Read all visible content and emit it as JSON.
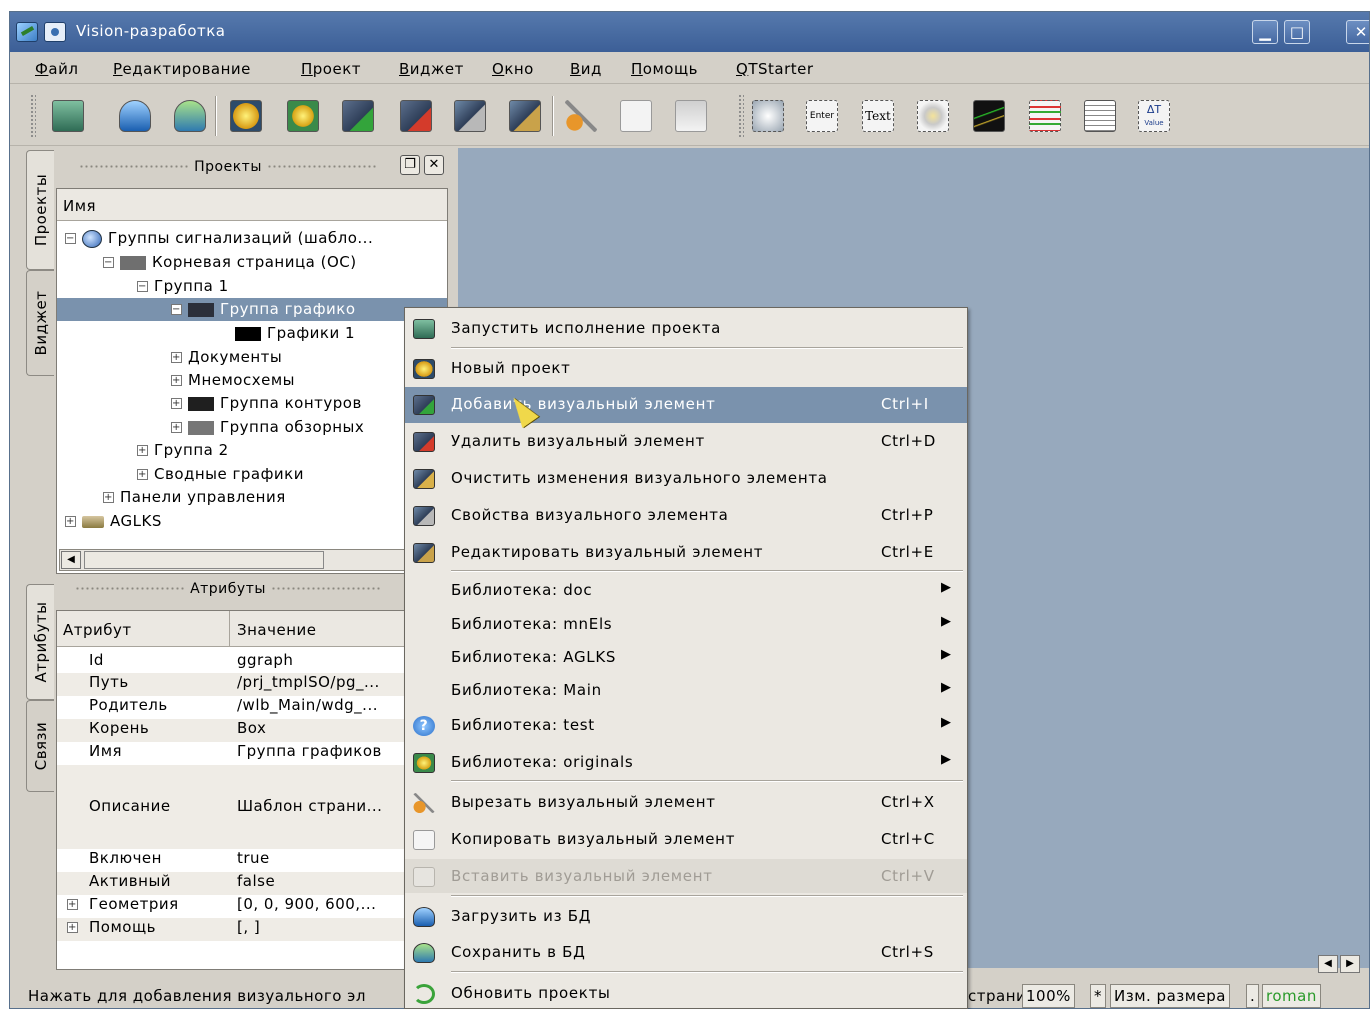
{
  "window": {
    "title": "Vision-разработка"
  },
  "menubar": {
    "items": [
      "Файл",
      "Редактирование",
      "Проект",
      "Виджет",
      "Окно",
      "Вид",
      "Помощь",
      "QTStarter"
    ]
  },
  "toolbar": {
    "icons": [
      "run-project-icon",
      "load-db-icon",
      "save-db-icon",
      "new-project-icon",
      "new-lib-icon",
      "add-widget-icon",
      "delete-widget-icon",
      "widget-properties-icon",
      "edit-widget-icon",
      "cut-icon",
      "copy-icon",
      "paste-icon",
      "widget-button-icon",
      "widget-enter-icon",
      "widget-text-icon",
      "widget-media-icon",
      "widget-diagram-icon",
      "widget-protocol-icon",
      "widget-document-icon",
      "widget-value-icon"
    ],
    "labels": {
      "enter": "Enter",
      "text": "Text",
      "value_top": "ΔT",
      "value_bottom": "Value"
    }
  },
  "left_tabs": {
    "projects": "Проекты",
    "widget": "Виджет",
    "attributes": "Атрибуты",
    "links": "Связи"
  },
  "projects_panel": {
    "title": "Проекты",
    "column": "Имя",
    "tree": [
      {
        "label": "Группы сигнализаций (шабло...",
        "icon": "project-globe-icon"
      },
      {
        "label": "Корневая страница (ОС)",
        "icon": "page-gray-icon"
      },
      {
        "label": "Группа 1",
        "icon": ""
      },
      {
        "label": "Группа графико",
        "icon": "page-dark-icon"
      },
      {
        "label": "Графики 1",
        "icon": "page-black-icon"
      },
      {
        "label": "Документы",
        "icon": ""
      },
      {
        "label": "Мнемосхемы",
        "icon": ""
      },
      {
        "label": "Группа контуров",
        "icon": "page-dark-icon"
      },
      {
        "label": "Группа обзорных",
        "icon": "page-gray-icon"
      },
      {
        "label": "Группа 2",
        "icon": ""
      },
      {
        "label": "Сводные графики",
        "icon": ""
      },
      {
        "label": "Панели управления",
        "icon": ""
      },
      {
        "label": "AGLKS",
        "icon": "project-aglks-icon"
      }
    ]
  },
  "attributes_panel": {
    "title": "Атрибуты",
    "columns": [
      "Атрибут",
      "Значение"
    ],
    "rows": [
      {
        "name": "Id",
        "value": "ggraph"
      },
      {
        "name": "Путь",
        "value": "/prj_tmplSO/pg_..."
      },
      {
        "name": "Родитель",
        "value": "/wlb_Main/wdg_..."
      },
      {
        "name": "Корень",
        "value": "Box"
      },
      {
        "name": "Имя",
        "value": "Группа графиков"
      },
      {
        "name": "Описание",
        "value": "Шаблон страни..."
      },
      {
        "name": "Включен",
        "value": "true"
      },
      {
        "name": "Активный",
        "value": "false"
      },
      {
        "name": "Геометрия",
        "value": "[0, 0, 900, 600,..."
      },
      {
        "name": "Помощь",
        "value": "[, ]"
      }
    ]
  },
  "context_menu": {
    "items": [
      {
        "label": "Запустить исполнение проекта",
        "shortcut": "",
        "icon": "run-project-icon"
      },
      {
        "label": "Новый проект",
        "shortcut": "",
        "icon": "new-project-icon"
      },
      {
        "label": "Добавить визуальный элемент",
        "shortcut": "Ctrl+I",
        "icon": "add-widget-icon"
      },
      {
        "label": "Удалить визуальный элемент",
        "shortcut": "Ctrl+D",
        "icon": "delete-widget-icon"
      },
      {
        "label": "Очистить изменения визуального элемента",
        "shortcut": "",
        "icon": "clear-changes-icon"
      },
      {
        "label": "Свойства визуального элемента",
        "shortcut": "Ctrl+P",
        "icon": "widget-properties-icon"
      },
      {
        "label": "Редактировать визуальный элемент",
        "shortcut": "Ctrl+E",
        "icon": "edit-widget-icon"
      },
      {
        "label": "Библиотека: doc",
        "shortcut": "",
        "icon": ""
      },
      {
        "label": "Библиотека: mnEls",
        "shortcut": "",
        "icon": ""
      },
      {
        "label": "Библиотека: AGLKS",
        "shortcut": "",
        "icon": ""
      },
      {
        "label": "Библиотека: Main",
        "shortcut": "",
        "icon": ""
      },
      {
        "label": "Библиотека: test",
        "shortcut": "",
        "icon": "help-icon"
      },
      {
        "label": "Библиотека: originals",
        "shortcut": "",
        "icon": "library-icon"
      },
      {
        "label": "Вырезать визуальный элемент",
        "shortcut": "Ctrl+X",
        "icon": "cut-icon"
      },
      {
        "label": "Копировать визуальный элемент",
        "shortcut": "Ctrl+C",
        "icon": "copy-icon"
      },
      {
        "label": "Вставить визуальный элемент",
        "shortcut": "Ctrl+V",
        "icon": "paste-icon"
      },
      {
        "label": "Загрузить из БД",
        "shortcut": "",
        "icon": "load-db-icon"
      },
      {
        "label": "Сохранить в БД",
        "shortcut": "Ctrl+S",
        "icon": "save-db-icon"
      },
      {
        "label": "Обновить проекты",
        "shortcut": "",
        "icon": "refresh-icon"
      }
    ],
    "highlighted_index": 2,
    "disabled_index": 15
  },
  "statusbar": {
    "message": "Нажать для добавления визуального эл",
    "page_fragment": "страни",
    "zoom": "100%",
    "modified": "*",
    "resize_mode": "Изм. размера",
    "dot": ".",
    "user": "roman"
  },
  "colors": {
    "highlight": "#7a92ad",
    "workspace": "#97a9bd",
    "titlebar": "#4a6da4",
    "user_text": "#2a9a2a"
  }
}
